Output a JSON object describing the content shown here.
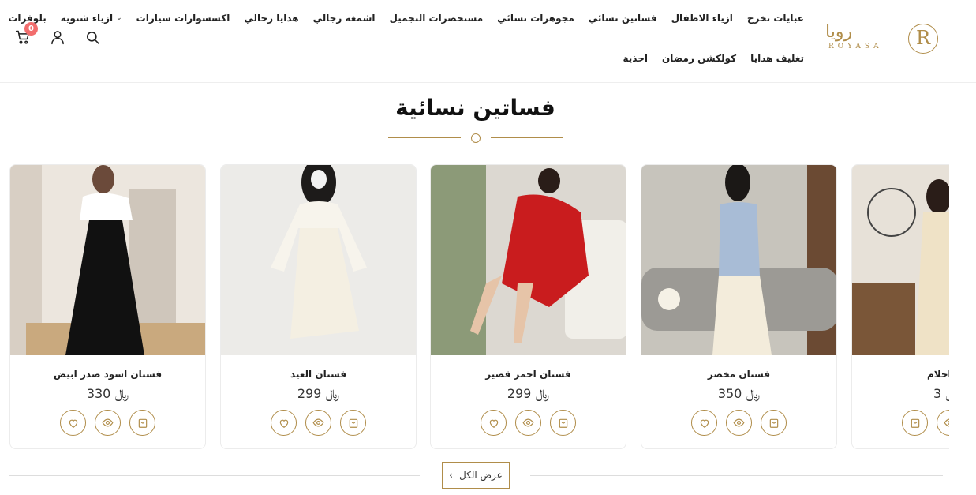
{
  "header": {
    "logo": {
      "arabic": "رويا",
      "latin": "ROYASA",
      "monogram": "R"
    },
    "nav_row1": [
      {
        "label": "عبايات تخرج"
      },
      {
        "label": "ازياء الاطفال"
      },
      {
        "label": "فساتين نسائي"
      },
      {
        "label": "مجوهرات نسائي"
      },
      {
        "label": "مستحضرات التجميل"
      },
      {
        "label": "اشمغة رجالي"
      },
      {
        "label": "هدايا رجالي"
      },
      {
        "label": "اكسسوارات سيارات"
      },
      {
        "label": "ازياء شتوية",
        "dropdown": true
      },
      {
        "label": "بلوفرات"
      }
    ],
    "nav_row2": [
      {
        "label": "تغليف هدايا"
      },
      {
        "label": "كولكشن رمضان"
      },
      {
        "label": "احذية"
      }
    ],
    "cart_count": "0",
    "icons": [
      "cart-icon",
      "user-icon",
      "search-icon"
    ]
  },
  "section": {
    "title": "فساتين نسائية"
  },
  "products": [
    {
      "name": "فستان اسود صدر ابيض",
      "price": "330",
      "currency": "﷼"
    },
    {
      "name": "فستان العيد",
      "price": "299",
      "currency": "﷼"
    },
    {
      "name": "فستان احمر قصير",
      "price": "299",
      "currency": "﷼"
    },
    {
      "name": "فستان مخصر",
      "price": "350",
      "currency": "﷼"
    },
    {
      "name": "فستان احلام",
      "price": "3",
      "currency": "﷼"
    }
  ],
  "view_all": {
    "label": "عرض الكل"
  },
  "colors": {
    "accent": "#b08d4a",
    "badge": "#f26d6d"
  }
}
